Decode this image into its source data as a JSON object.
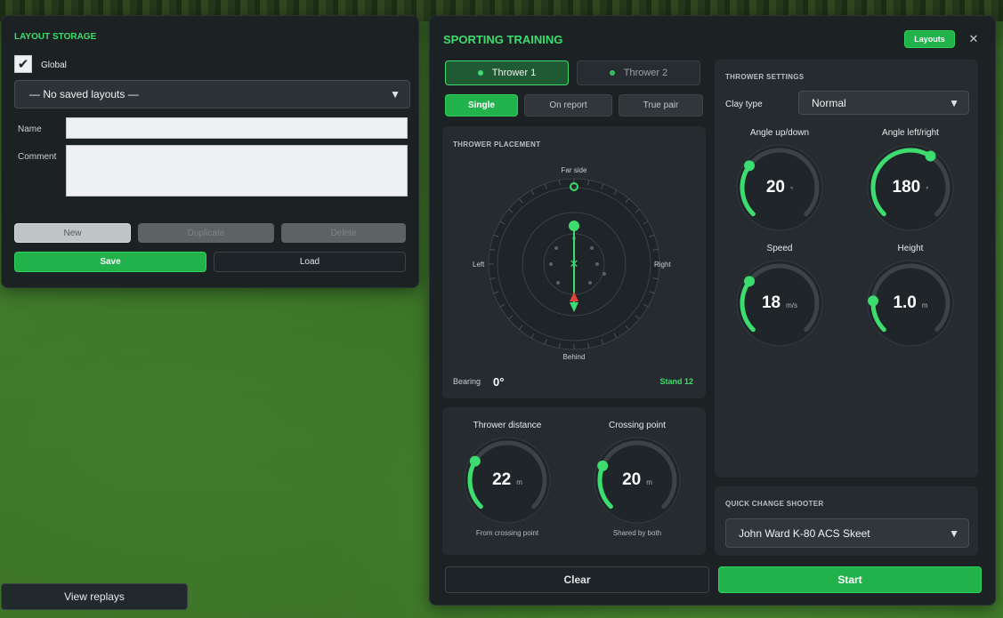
{
  "layout_storage": {
    "title": "LAYOUT STORAGE",
    "global_label": "Global",
    "global_checked": true,
    "layouts_select": "— No saved layouts —",
    "name_label": "Name",
    "name_value": "",
    "comment_label": "Comment",
    "comment_value": "",
    "new_label": "New",
    "duplicate_label": "Duplicate",
    "delete_label": "Delete",
    "save_label": "Save",
    "load_label": "Load"
  },
  "view_replays_label": "View replays",
  "training": {
    "title": "SPORTING TRAINING",
    "layouts_label": "Layouts",
    "close_glyph": "✕",
    "thrower_tabs": [
      "Thrower 1",
      "Thrower 2"
    ],
    "active_thrower": 0,
    "modes": [
      "Single",
      "On report",
      "True pair"
    ],
    "active_mode": 0,
    "placement": {
      "title": "THROWER PLACEMENT",
      "far_side": "Far side",
      "left": "Left",
      "right": "Right",
      "behind": "Behind",
      "bearing_label": "Bearing",
      "bearing_value": "0°",
      "stand_label": "Stand 12"
    },
    "distance_knobs": [
      {
        "title": "Thrower distance",
        "value": "22",
        "unit": "m",
        "sub": "From crossing point",
        "fraction": 0.28
      },
      {
        "title": "Crossing point",
        "value": "20",
        "unit": "m",
        "sub": "Shared by both",
        "fraction": 0.25
      }
    ],
    "settings": {
      "title": "THROWER SETTINGS",
      "clay_type_label": "Clay type",
      "clay_type_value": "Normal",
      "knobs": [
        {
          "title": "Angle up/down",
          "value": "20",
          "unit": "°",
          "fraction": 0.3
        },
        {
          "title": "Angle left/right",
          "value": "180",
          "unit": "°",
          "fraction": 0.62
        },
        {
          "title": "Speed",
          "value": "18",
          "unit": "m/s",
          "fraction": 0.3
        },
        {
          "title": "Height",
          "value": "1.0",
          "unit": "m",
          "fraction": 0.18
        }
      ]
    },
    "shooter": {
      "title": "QUICK CHANGE SHOOTER",
      "value": "John Ward K-80 ACS Skeet"
    },
    "clear_label": "Clear",
    "start_label": "Start"
  },
  "colors": {
    "accent": "#3ddc6e",
    "accent_dark": "#22b24c",
    "panel": "#1c2124",
    "arrow_red": "#e0433a"
  },
  "icons": {
    "check": "check-icon",
    "caret": "caret-down-icon",
    "close": "close-icon"
  }
}
